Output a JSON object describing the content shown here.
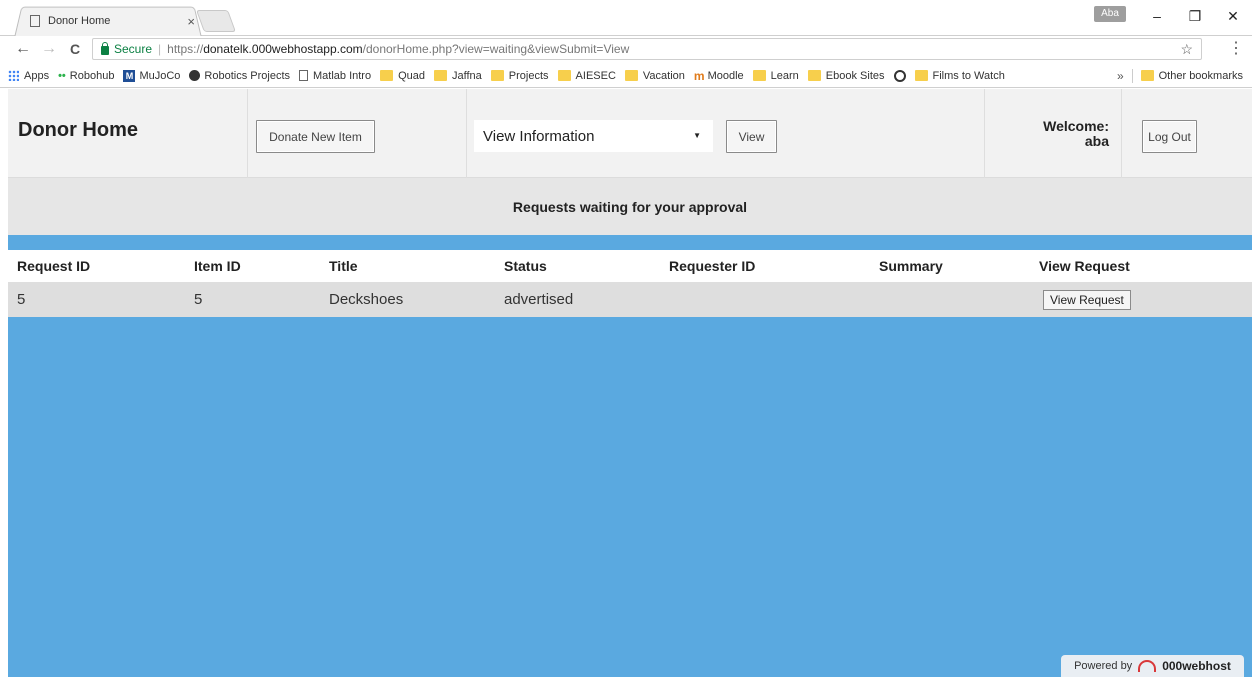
{
  "browser": {
    "tab_title": "Donor Home",
    "tab_close": "×",
    "profile": "Aba",
    "window_controls": [
      "–",
      "❐",
      "✕"
    ],
    "nav": {
      "back": "←",
      "forward": "→",
      "reload": "C"
    },
    "address": {
      "secure_label": "Secure",
      "separator": "|",
      "scheme": "https://",
      "host": "donatelk.000webhostapp.com",
      "path": "/donorHome.php?view=waiting&viewSubmit=View"
    },
    "bookmark_star": "☆",
    "menu": "⋮",
    "bookmarks": [
      {
        "label": "Apps",
        "icon": "apps-grid-icon"
      },
      {
        "label": "Robohub",
        "icon": "dots-icon"
      },
      {
        "label": "MuJoCo",
        "icon": "m-logo-icon"
      },
      {
        "label": "Robotics Projects",
        "icon": "github-icon"
      },
      {
        "label": "Matlab Intro",
        "icon": "page-icon"
      },
      {
        "label": "Quad",
        "icon": "folder-icon"
      },
      {
        "label": "Jaffna",
        "icon": "folder-icon"
      },
      {
        "label": "Projects",
        "icon": "folder-icon"
      },
      {
        "label": "AIESEC",
        "icon": "folder-icon"
      },
      {
        "label": "Vacation",
        "icon": "folder-icon"
      },
      {
        "label": "Moodle",
        "icon": "moodle-icon"
      },
      {
        "label": "Learn",
        "icon": "folder-icon"
      },
      {
        "label": "Ebook Sites",
        "icon": "folder-icon"
      },
      {
        "label": "",
        "icon": "circle-logo-icon"
      },
      {
        "label": "Films to Watch",
        "icon": "folder-icon"
      }
    ],
    "bookmarks_more": "»",
    "other_bookmarks": "Other bookmarks"
  },
  "header": {
    "title": "Donor Home",
    "donate_button": "Donate New Item",
    "select_value": "View Information",
    "view_button": "View",
    "welcome_label": "Welcome:",
    "username": "aba",
    "logout_button": "Log Out"
  },
  "subheader": "Requests waiting for your approval",
  "table": {
    "columns": [
      "Request ID",
      "Item ID",
      "Title",
      "Status",
      "Requester ID",
      "Summary",
      "View Request"
    ],
    "rows": [
      {
        "request_id": "5",
        "item_id": "5",
        "title": "Deckshoes",
        "status": "advertised",
        "requester_id": "",
        "summary": "",
        "action": "View Request"
      }
    ]
  },
  "footer": {
    "powered_by": "Powered by",
    "brand": "000webhost"
  },
  "colors": {
    "page_bg": "#5aa9e0",
    "header_bg": "#f2f2f2",
    "subheader_bg": "#e6e6e6",
    "row_bg": "#dedede",
    "secure_green": "#0b8043"
  }
}
